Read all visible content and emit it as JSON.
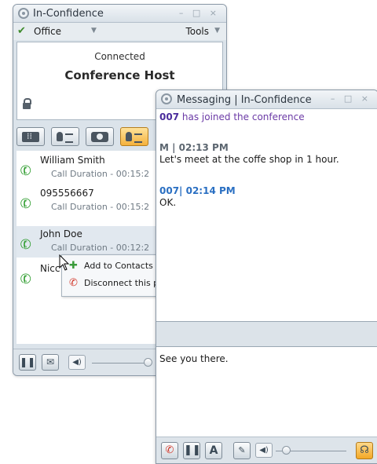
{
  "main_window": {
    "title": "In-Confidence",
    "window_controls": "– □ ×",
    "menu": {
      "office": "Office",
      "tools": "Tools"
    },
    "status": {
      "connection": "Connected",
      "host": "Conference Host"
    },
    "calls": [
      {
        "name": "William Smith",
        "duration": "Call Duration - 00:15:2",
        "extra": ""
      },
      {
        "name": "095556667",
        "duration": "Call Duration - 00:15:2",
        "extra": ""
      },
      {
        "name": "John Doe",
        "duration": "Call Duration - 00:12:2",
        "extra": "("
      },
      {
        "name": "Nicc",
        "duration": "",
        "extra": ""
      }
    ],
    "context_menu": {
      "add": "Add to Contacts",
      "disconnect": "Disconnect this p"
    }
  },
  "messaging_window": {
    "title": "Messaging | In-Confidence",
    "window_controls": "– □ ×",
    "join_user": "007",
    "join_text": " has joined the conference",
    "messages": [
      {
        "header": "M | 02:13 PM",
        "text": "Let's meet at the coffe shop in 1 hour."
      },
      {
        "header": "007| 02:14 PM",
        "text": "OK."
      }
    ],
    "compose_text": "See you there.",
    "toolbar": {
      "font_label": "A"
    }
  },
  "colors": {
    "accent_orange": "#f4b13c",
    "join_purple": "#6b3aa6",
    "msg_blue": "#2a6fc2"
  }
}
